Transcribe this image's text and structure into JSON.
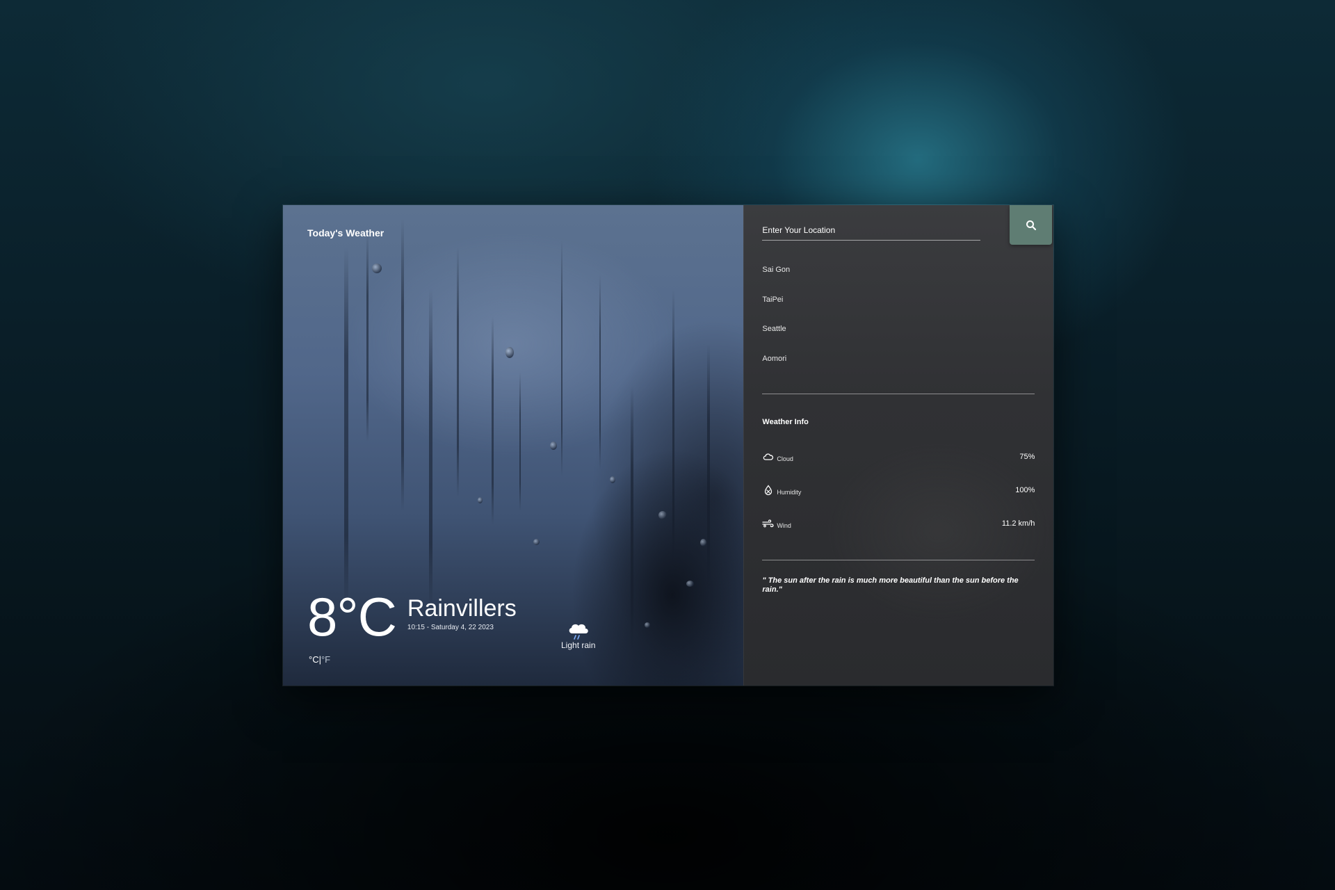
{
  "left_panel": {
    "heading": "Today's Weather",
    "temperature": "8°C",
    "city": "Rainvillers",
    "datetime": "10:15 - Saturday 4, 22 2023",
    "condition": "Light rain",
    "condition_icon": "cloud-rain-icon",
    "unit_c": "°C",
    "unit_separator": "|",
    "unit_f": "°F"
  },
  "search": {
    "placeholder": "Enter Your Location",
    "button_icon": "search-icon",
    "button_color": "#5f7d73"
  },
  "cities": [
    "Sai Gon",
    "TaiPei",
    "Seattle",
    "Aomori"
  ],
  "weather_info": {
    "title": "Weather Info",
    "rows": [
      {
        "icon": "cloud-icon",
        "label": "Cloud",
        "value": "75%"
      },
      {
        "icon": "humidity-icon",
        "label": "Humidity",
        "value": "100%"
      },
      {
        "icon": "wind-icon",
        "label": "Wind",
        "value": "11.2 km/h"
      }
    ]
  },
  "quote": "\" The sun after the rain is much more beautiful than the sun before the rain.\""
}
